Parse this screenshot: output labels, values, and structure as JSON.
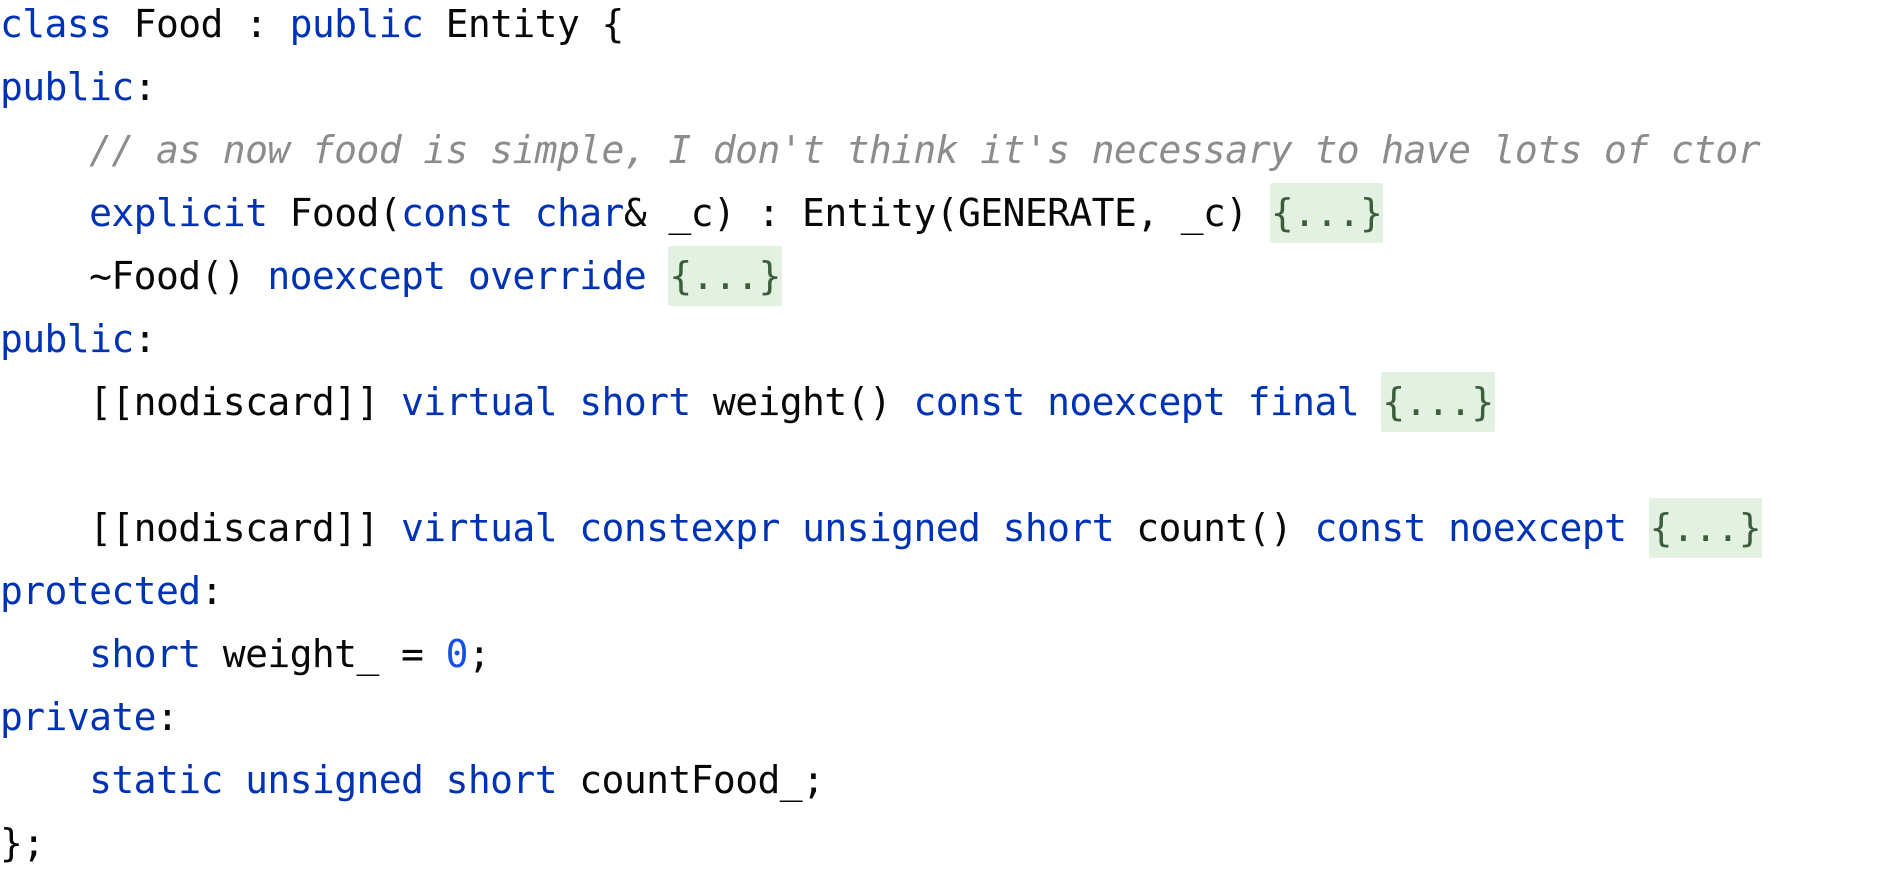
{
  "lines": [
    {
      "id": "class-decl",
      "indent": "",
      "tokens": [
        {
          "text": "class",
          "type": "kw"
        },
        {
          "text": " Food : ",
          "type": "plain"
        },
        {
          "text": "public",
          "type": "kw"
        },
        {
          "text": " Entity {",
          "type": "plain"
        }
      ]
    },
    {
      "id": "access-public-1",
      "indent": "",
      "tokens": [
        {
          "text": "public",
          "type": "kw"
        },
        {
          "text": ":",
          "type": "plain"
        }
      ]
    },
    {
      "id": "comment",
      "indent": "    ",
      "tokens": [
        {
          "text": "// as now food is simple, I don't think it's necessary to have lots of ctor",
          "type": "comment"
        }
      ]
    },
    {
      "id": "ctor",
      "indent": "    ",
      "tokens": [
        {
          "text": "explicit",
          "type": "kw"
        },
        {
          "text": " Food(",
          "type": "plain"
        },
        {
          "text": "const",
          "type": "kw"
        },
        {
          "text": " ",
          "type": "plain"
        },
        {
          "text": "char",
          "type": "kw"
        },
        {
          "text": "& _c) : Entity(GENERATE, _c) ",
          "type": "plain"
        },
        {
          "text": "{...}",
          "type": "fold"
        }
      ]
    },
    {
      "id": "dtor",
      "indent": "    ",
      "tokens": [
        {
          "text": "~Food() ",
          "type": "plain"
        },
        {
          "text": "noexcept",
          "type": "kw"
        },
        {
          "text": " ",
          "type": "plain"
        },
        {
          "text": "override",
          "type": "kw"
        },
        {
          "text": " ",
          "type": "plain"
        },
        {
          "text": "{...}",
          "type": "fold"
        }
      ]
    },
    {
      "id": "access-public-2",
      "indent": "",
      "tokens": [
        {
          "text": "public",
          "type": "kw"
        },
        {
          "text": ":",
          "type": "plain"
        }
      ]
    },
    {
      "id": "method-weight",
      "indent": "    ",
      "tokens": [
        {
          "text": "[[nodiscard]] ",
          "type": "plain"
        },
        {
          "text": "virtual",
          "type": "kw"
        },
        {
          "text": " ",
          "type": "plain"
        },
        {
          "text": "short",
          "type": "kw"
        },
        {
          "text": " weight() ",
          "type": "plain"
        },
        {
          "text": "const",
          "type": "kw"
        },
        {
          "text": " ",
          "type": "plain"
        },
        {
          "text": "noexcept",
          "type": "kw"
        },
        {
          "text": " ",
          "type": "plain"
        },
        {
          "text": "final",
          "type": "kw"
        },
        {
          "text": " ",
          "type": "plain"
        },
        {
          "text": "{...}",
          "type": "fold"
        }
      ]
    },
    {
      "id": "blank",
      "indent": "",
      "tokens": []
    },
    {
      "id": "method-count",
      "indent": "    ",
      "tokens": [
        {
          "text": "[[nodiscard]] ",
          "type": "plain"
        },
        {
          "text": "virtual",
          "type": "kw"
        },
        {
          "text": " ",
          "type": "plain"
        },
        {
          "text": "constexpr",
          "type": "kw"
        },
        {
          "text": " ",
          "type": "plain"
        },
        {
          "text": "unsigned",
          "type": "kw"
        },
        {
          "text": " ",
          "type": "plain"
        },
        {
          "text": "short",
          "type": "kw"
        },
        {
          "text": " count() ",
          "type": "plain"
        },
        {
          "text": "const",
          "type": "kw"
        },
        {
          "text": " ",
          "type": "plain"
        },
        {
          "text": "noexcept",
          "type": "kw"
        },
        {
          "text": " ",
          "type": "plain"
        },
        {
          "text": "{...}",
          "type": "fold"
        }
      ]
    },
    {
      "id": "access-protected",
      "indent": "",
      "tokens": [
        {
          "text": "protected",
          "type": "kw"
        },
        {
          "text": ":",
          "type": "plain"
        }
      ]
    },
    {
      "id": "field-weight",
      "indent": "    ",
      "tokens": [
        {
          "text": "short",
          "type": "kw"
        },
        {
          "text": " weight_ = ",
          "type": "plain"
        },
        {
          "text": "0",
          "type": "num"
        },
        {
          "text": ";",
          "type": "plain"
        }
      ]
    },
    {
      "id": "access-private",
      "indent": "",
      "tokens": [
        {
          "text": "private",
          "type": "kw"
        },
        {
          "text": ":",
          "type": "plain"
        }
      ]
    },
    {
      "id": "field-countfood",
      "indent": "    ",
      "tokens": [
        {
          "text": "static",
          "type": "kw"
        },
        {
          "text": " ",
          "type": "plain"
        },
        {
          "text": "unsigned",
          "type": "kw"
        },
        {
          "text": " ",
          "type": "plain"
        },
        {
          "text": "short",
          "type": "kw"
        },
        {
          "text": " countFood_;",
          "type": "plain"
        }
      ]
    },
    {
      "id": "class-close",
      "indent": "",
      "tokens": [
        {
          "text": "};",
          "type": "plain"
        }
      ]
    }
  ],
  "colors": {
    "keyword": "#0033b3",
    "text": "#080808",
    "comment": "#8c8c8c",
    "number": "#1750eb",
    "fold_bg": "#e3f1e3",
    "fold_text": "#3b5e3b",
    "background": "#ffffff"
  }
}
